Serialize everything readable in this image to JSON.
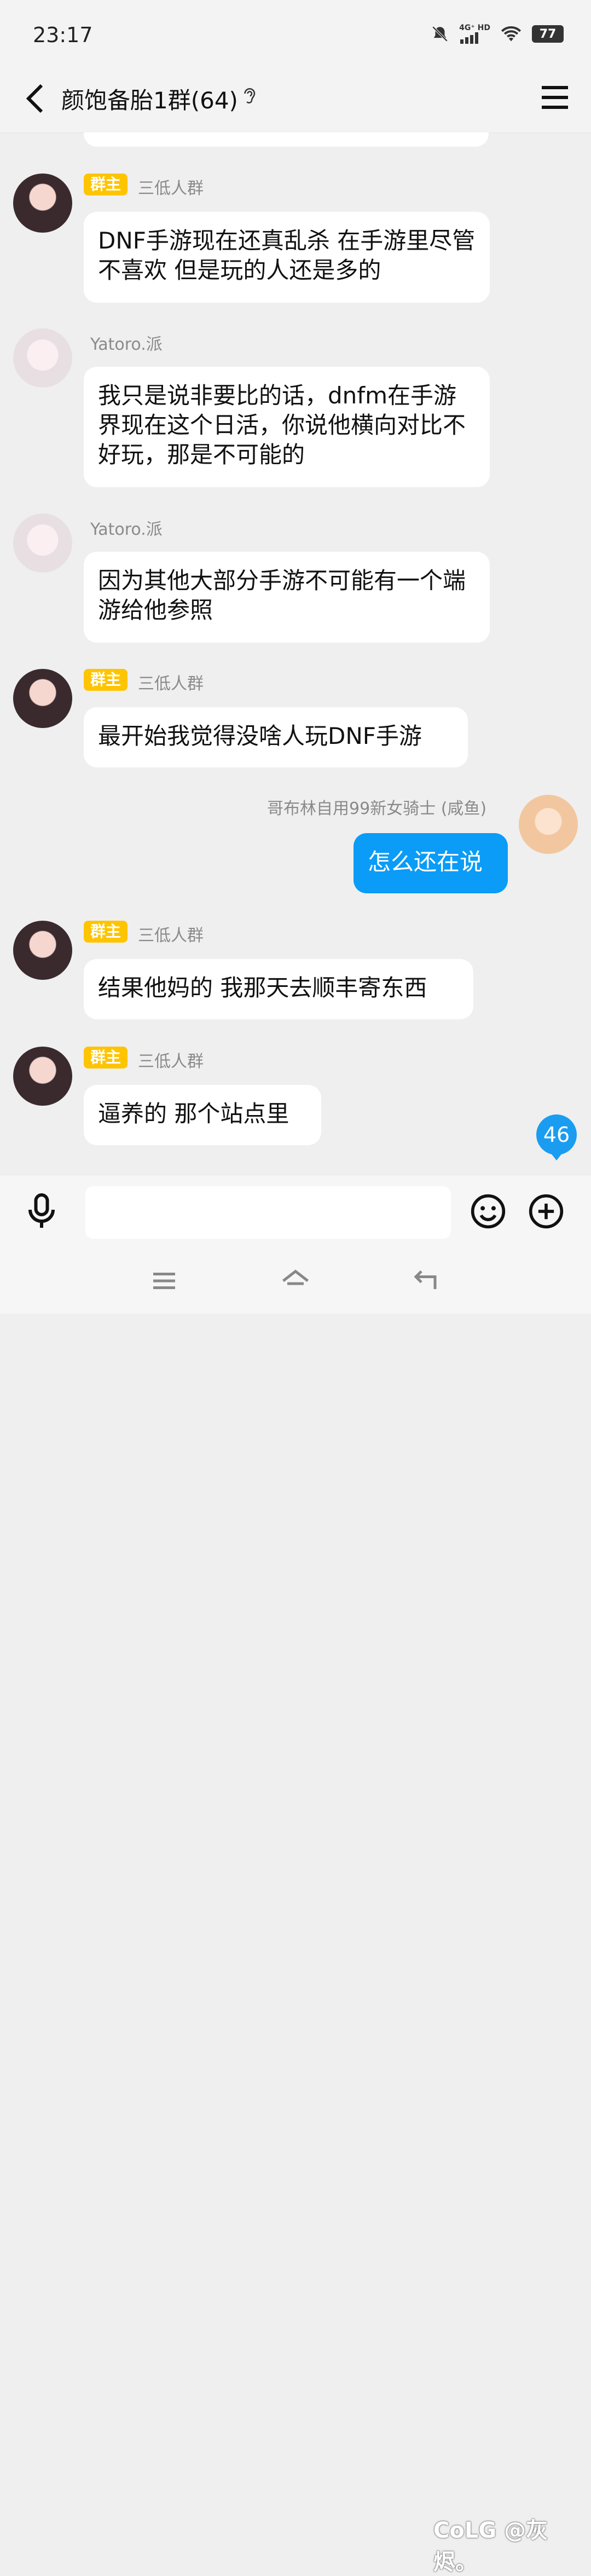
{
  "status": {
    "time": "23:17",
    "network": "4G⁺ HD",
    "battery": "77"
  },
  "header": {
    "title": "颜饱备胎1群(64)"
  },
  "messages": [
    {
      "badge": "群主",
      "name": "三低人群",
      "text": "DNF手游现在还真乱杀 在手游里尽管不喜欢 但是玩的人还是多的"
    },
    {
      "badge": "",
      "name": "Yatoro.派",
      "text": "我只是说非要比的话，dnfm在手游界现在这个日活，你说他横向对比不好玩，那是不可能的"
    },
    {
      "badge": "",
      "name": "Yatoro.派",
      "text": "因为其他大部分手游不可能有一个端游给他参照"
    },
    {
      "badge": "群主",
      "name": "三低人群",
      "text": "最开始我觉得没啥人玩DNF手游"
    },
    {
      "badge": "",
      "name": "哥布林自用99新女骑士 (咸鱼)",
      "text": "怎么还在说"
    },
    {
      "badge": "群主",
      "name": "三低人群",
      "text": "结果他妈的 我那天去顺丰寄东西"
    },
    {
      "badge": "群主",
      "name": "三低人群",
      "text": "逼养的 那个站点里"
    }
  ],
  "unread_count": "46",
  "watermark": "CoLG @灰烬。",
  "colors": {
    "accent": "#0a9cf6",
    "badge": "#ffc400",
    "background": "#efefef"
  }
}
